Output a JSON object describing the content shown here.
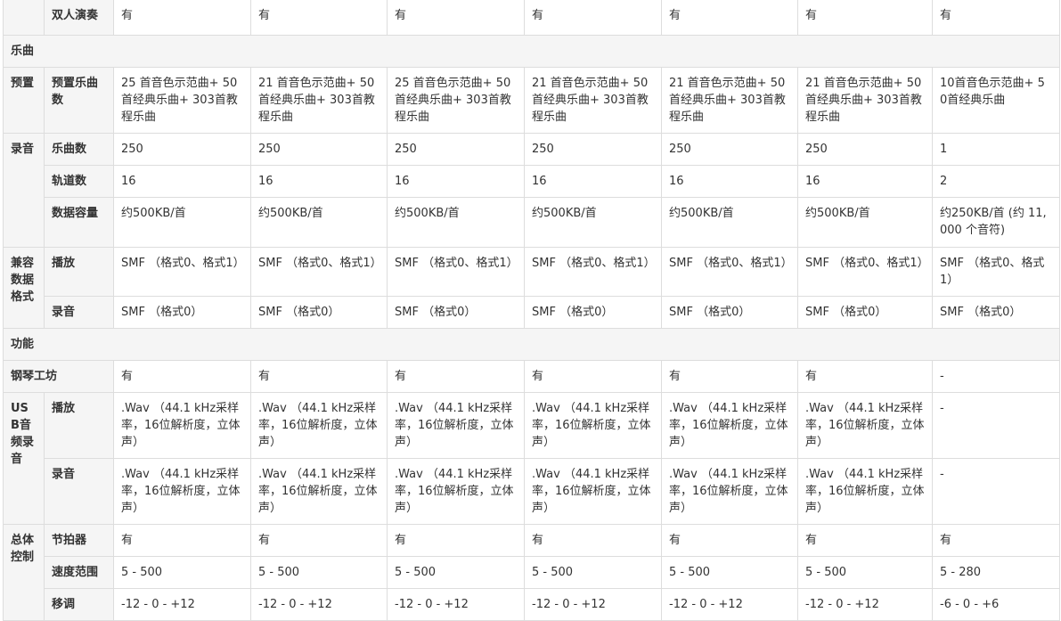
{
  "rows": [
    {
      "group": "",
      "label": "双人演奏",
      "cells": [
        "有",
        "有",
        "有",
        "有",
        "有",
        "有",
        "有"
      ]
    },
    {
      "section": "乐曲"
    },
    {
      "group": "预置",
      "label": "预置乐曲数",
      "cells": [
        "25 首音色示范曲+ 50首经典乐曲+ 303首教程乐曲",
        "21 首音色示范曲+ 50首经典乐曲+ 303首教程乐曲",
        "25 首音色示范曲+ 50首经典乐曲+ 303首教程乐曲",
        "21 首音色示范曲+ 50首经典乐曲+ 303首教程乐曲",
        "21 首音色示范曲+ 50首经典乐曲+ 303首教程乐曲",
        "21 首音色示范曲+ 50首经典乐曲+ 303首教程乐曲",
        "10首音色示范曲+ 50首经典乐曲"
      ]
    },
    {
      "group": "录音",
      "label": "乐曲数",
      "cells": [
        "250",
        "250",
        "250",
        "250",
        "250",
        "250",
        "1"
      ]
    },
    {
      "label": "轨道数",
      "cells": [
        "16",
        "16",
        "16",
        "16",
        "16",
        "16",
        "2"
      ]
    },
    {
      "label": "数据容量",
      "cells": [
        "约500KB/首",
        "约500KB/首",
        "约500KB/首",
        "约500KB/首",
        "约500KB/首",
        "约500KB/首",
        "约250KB/首 (约 11,000 个音符)"
      ]
    },
    {
      "group": "兼容数据格式",
      "label": "播放",
      "cells": [
        "SMF （格式0、格式1）",
        "SMF （格式0、格式1）",
        "SMF （格式0、格式1）",
        "SMF （格式0、格式1）",
        "SMF （格式0、格式1）",
        "SMF （格式0、格式1）",
        "SMF （格式0、格式1）"
      ]
    },
    {
      "label": "录音",
      "cells": [
        "SMF （格式0）",
        "SMF （格式0）",
        "SMF （格式0）",
        "SMF （格式0）",
        "SMF （格式0）",
        "SMF （格式0）",
        "SMF （格式0）"
      ]
    },
    {
      "section": "功能"
    },
    {
      "group": "钢琴工坊",
      "cells": [
        "有",
        "有",
        "有",
        "有",
        "有",
        "有",
        "-"
      ]
    },
    {
      "group": "USB音频录音",
      "label": "播放",
      "cells": [
        ".Wav （44.1 kHz采样率，16位解析度，立体声）",
        ".Wav （44.1 kHz采样率，16位解析度，立体声）",
        ".Wav （44.1 kHz采样率，16位解析度，立体声）",
        ".Wav （44.1 kHz采样率，16位解析度，立体声）",
        ".Wav （44.1 kHz采样率，16位解析度，立体声）",
        ".Wav （44.1 kHz采样率，16位解析度，立体声）",
        "-"
      ]
    },
    {
      "label": "录音",
      "cells": [
        ".Wav （44.1 kHz采样率，16位解析度，立体声）",
        ".Wav （44.1 kHz采样率，16位解析度，立体声）",
        ".Wav （44.1 kHz采样率，16位解析度，立体声）",
        ".Wav （44.1 kHz采样率，16位解析度，立体声）",
        ".Wav （44.1 kHz采样率，16位解析度，立体声）",
        ".Wav （44.1 kHz采样率，16位解析度，立体声）",
        "-"
      ]
    },
    {
      "group": "总体控制",
      "label": "节拍器",
      "cells": [
        "有",
        "有",
        "有",
        "有",
        "有",
        "有",
        "有"
      ]
    },
    {
      "label": "速度范围",
      "cells": [
        "5 - 500",
        "5 - 500",
        "5 - 500",
        "5 - 500",
        "5 - 500",
        "5 - 500",
        "5 - 280"
      ]
    },
    {
      "label": "移调",
      "cells": [
        "-12 - 0 - +12",
        "-12 - 0 - +12",
        "-12 - 0 - +12",
        "-12 - 0 - +12",
        "-12 - 0 - +12",
        "-12 - 0 - +12",
        "-6 - 0 - +6"
      ]
    }
  ],
  "colors": {
    "header_bg": "#f5f5f5",
    "border": "#dddddd",
    "text": "#333333"
  }
}
